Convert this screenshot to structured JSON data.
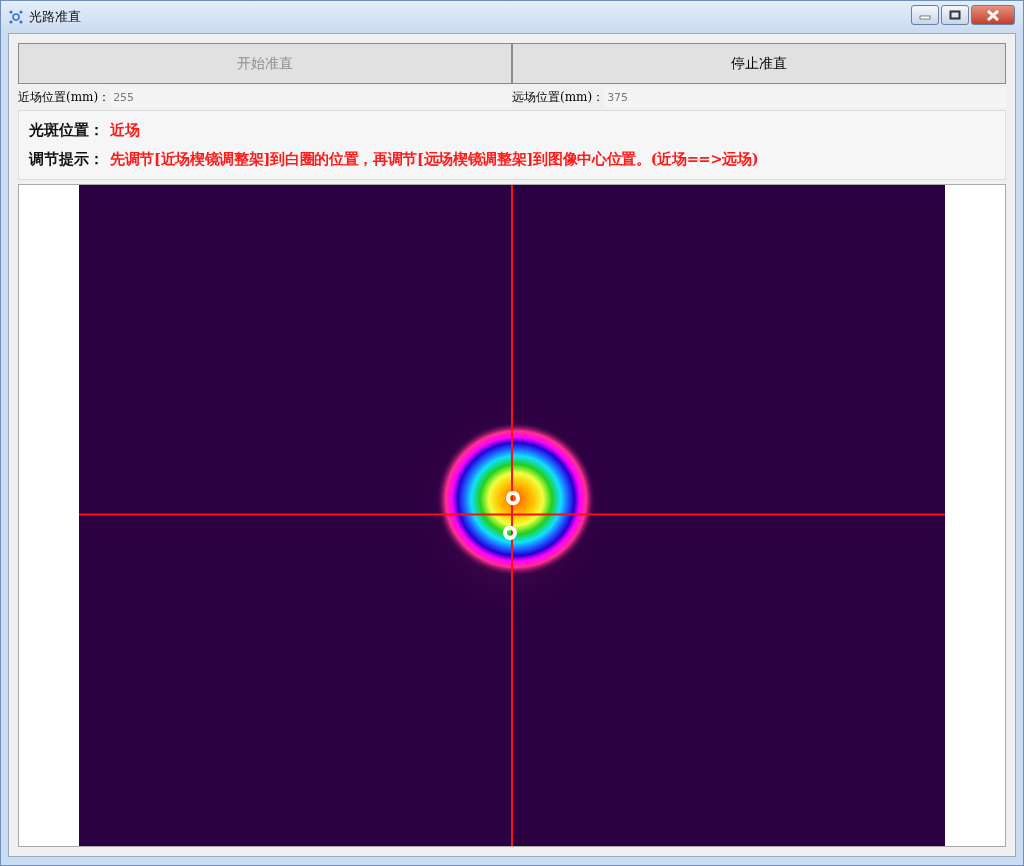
{
  "window": {
    "title": "光路准直"
  },
  "buttons": [
    {
      "label": "开始准直",
      "disabled": true
    },
    {
      "label": "停止准直",
      "disabled": false
    }
  ],
  "fields": [
    {
      "label": "近场位置(mm)：",
      "value": "255"
    },
    {
      "label": "远场位置(mm)：",
      "value": "375"
    }
  ],
  "info": [
    {
      "label": "光斑位置：",
      "text": "近场"
    },
    {
      "label": "调节提示：",
      "text": "先调节[近场楔镜调整架]到白圈的位置，再调节[远场楔镜调整架]到图像中心位置。(近场==>远场)"
    }
  ]
}
